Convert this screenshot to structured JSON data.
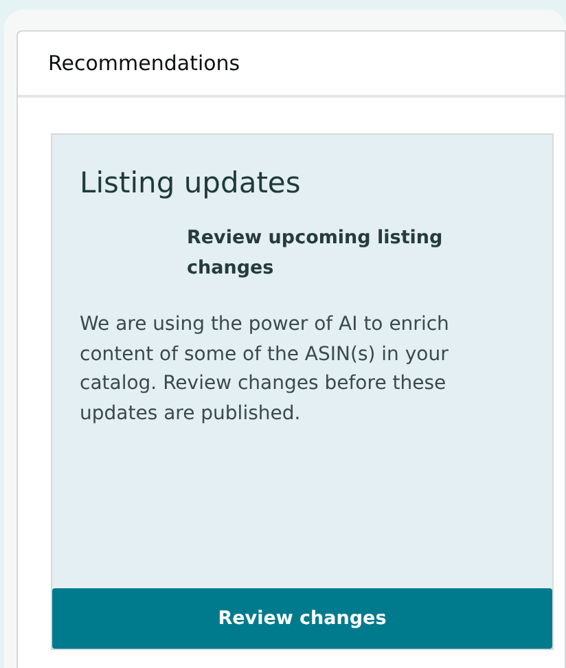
{
  "panel": {
    "title": "Recommendations"
  },
  "card": {
    "title": "Listing updates",
    "subtitle": "Review upcoming listing changes",
    "description": "We are using the power of AI to enrich content of some of the ASIN(s) in your catalog. Review changes before these updates are published.",
    "button": "Review changes"
  }
}
